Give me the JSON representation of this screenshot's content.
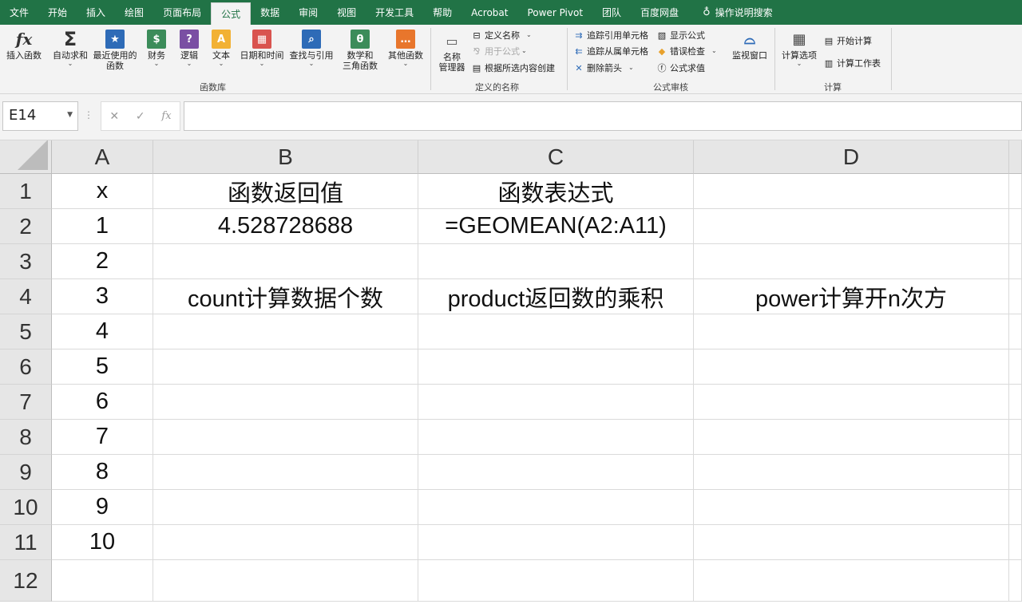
{
  "menu": {
    "tabs": [
      "文件",
      "开始",
      "插入",
      "绘图",
      "页面布局",
      "公式",
      "数据",
      "审阅",
      "视图",
      "开发工具",
      "帮助",
      "Acrobat",
      "Power Pivot",
      "团队",
      "百度网盘"
    ],
    "active_tab": "公式",
    "tell_me": "操作说明搜索"
  },
  "ribbon": {
    "insert_function": "插入函数",
    "autosum": "自动求和",
    "recent_1": "最近使用的",
    "recent_2": "函数",
    "financial": "财务",
    "logical": "逻辑",
    "text": "文本",
    "datetime": "日期和时间",
    "lookup": "查找与引用",
    "math_1": "数学和",
    "math_2": "三角函数",
    "more": "其他函数",
    "group_library": "函数库",
    "name_manager_1": "名称",
    "name_manager_2": "管理器",
    "define_name": "定义名称",
    "use_in_formula": "用于公式",
    "create_from_selection": "根据所选内容创建",
    "group_names": "定义的名称",
    "trace_precedents": "追踪引用单元格",
    "trace_dependents": "追踪从属单元格",
    "remove_arrows": "删除箭头",
    "show_formulas": "显示公式",
    "error_checking": "错误检查",
    "evaluate_formula": "公式求值",
    "watch_window": "监视窗口",
    "group_audit": "公式审核",
    "calc_options": "计算选项",
    "calc_now": "开始计算",
    "calc_sheet": "计算工作表",
    "group_calc": "计算"
  },
  "formula_bar": {
    "name_box": "E14",
    "value": ""
  },
  "sheet": {
    "columns": [
      "A",
      "B",
      "C",
      "D"
    ],
    "rows": [
      "1",
      "2",
      "3",
      "4",
      "5",
      "6",
      "7",
      "8",
      "9",
      "10",
      "11",
      "12"
    ],
    "cells": [
      [
        "x",
        "函数返回值",
        "函数表达式",
        ""
      ],
      [
        "1",
        "4.528728688",
        "=GEOMEAN(A2:A11)",
        ""
      ],
      [
        "2",
        "",
        "",
        ""
      ],
      [
        "3",
        "count计算数据个数",
        "product返回数的乘积",
        "power计算开n次方"
      ],
      [
        "4",
        "",
        "",
        ""
      ],
      [
        "5",
        "",
        "",
        ""
      ],
      [
        "6",
        "",
        "",
        ""
      ],
      [
        "7",
        "",
        "",
        ""
      ],
      [
        "8",
        "",
        "",
        ""
      ],
      [
        "9",
        "",
        "",
        ""
      ],
      [
        "10",
        "",
        "",
        ""
      ],
      [
        "",
        "",
        "",
        ""
      ]
    ]
  },
  "colors": {
    "accent": "#217346"
  }
}
